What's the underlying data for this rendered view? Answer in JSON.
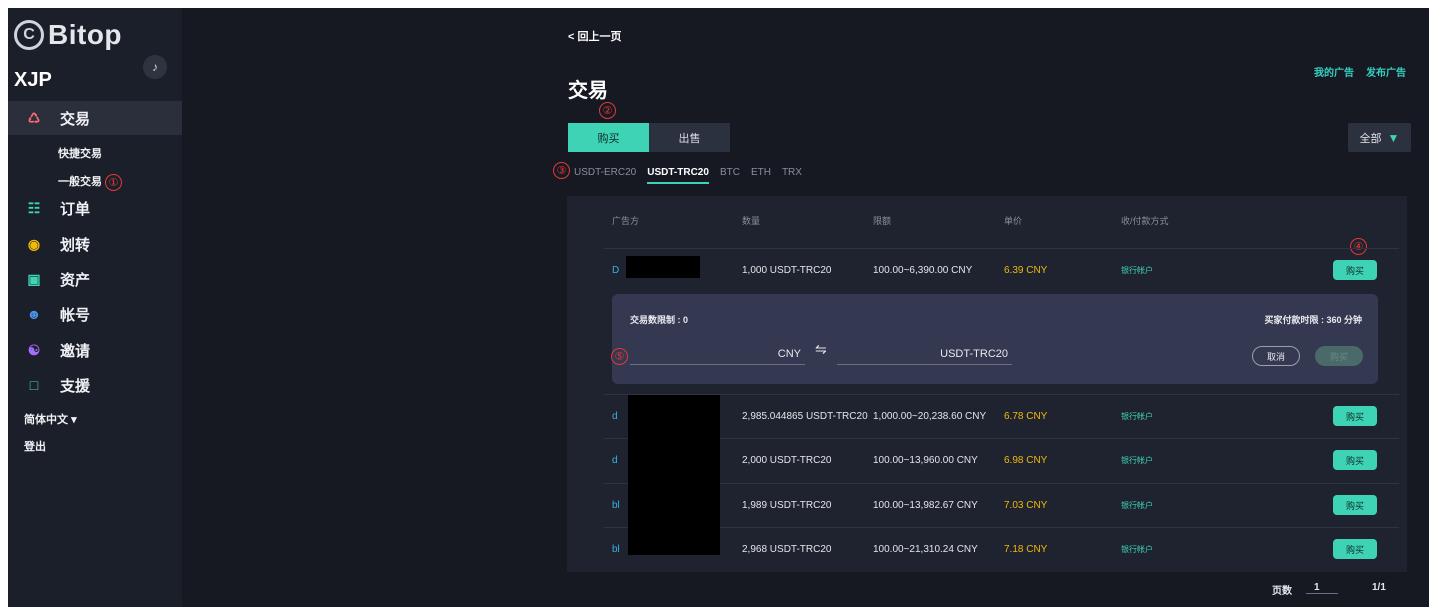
{
  "brand": {
    "name": "Bitop"
  },
  "user": {
    "name": "XJP"
  },
  "sidebar": {
    "items": [
      {
        "label": "交易",
        "icon": "trade-icon"
      },
      {
        "label": "订单",
        "icon": "order-icon"
      },
      {
        "label": "划转",
        "icon": "transfer-icon"
      },
      {
        "label": "资产",
        "icon": "wallet-icon"
      },
      {
        "label": "帐号",
        "icon": "account-icon"
      },
      {
        "label": "邀请",
        "icon": "invite-icon"
      },
      {
        "label": "支援",
        "icon": "support-icon"
      }
    ],
    "sub_items": [
      "快捷交易",
      "一般交易"
    ],
    "language": "简体中文",
    "logout": "登出"
  },
  "header": {
    "back": "< 回上一页",
    "title": "交易",
    "my_ads": "我的广告",
    "post_ad": "发布广告"
  },
  "tabs": {
    "buy": "购买",
    "sell": "出售"
  },
  "filter": {
    "label": "全部"
  },
  "coins": [
    "USDT-ERC20",
    "USDT-TRC20",
    "BTC",
    "ETH",
    "TRX"
  ],
  "selected_coin": "USDT-TRC20",
  "table": {
    "headers": [
      "广告方",
      "数量",
      "限额",
      "单价",
      "收/付款方式"
    ],
    "action_label": "购买",
    "rows": [
      {
        "advertiser": "D",
        "amount": "1,000 USDT-TRC20",
        "limit": "100.00~6,390.00 CNY",
        "price": "6.39 CNY",
        "method": "银行帐户"
      },
      {
        "advertiser": "d",
        "amount": "2,985.044865 USDT-TRC20",
        "limit": "1,000.00~20,238.60 CNY",
        "price": "6.78 CNY",
        "method": "银行帐户"
      },
      {
        "advertiser": "d",
        "amount": "2,000 USDT-TRC20",
        "limit": "100.00~13,960.00 CNY",
        "price": "6.98 CNY",
        "method": "银行帐户"
      },
      {
        "advertiser": "bl",
        "amount": "1,989 USDT-TRC20",
        "limit": "100.00~13,982.67 CNY",
        "price": "7.03 CNY",
        "method": "银行帐户"
      },
      {
        "advertiser": "bl",
        "amount": "2,968 USDT-TRC20",
        "limit": "100.00~21,310.24 CNY",
        "price": "7.18 CNY",
        "method": "银行帐户"
      }
    ]
  },
  "expand": {
    "limit_label": "交易数限制 : 0",
    "pay_time": "买家付款时限 : 360 分钟",
    "fiat_unit": "CNY",
    "crypto_unit": "USDT-TRC20",
    "cancel": "取消",
    "confirm": "购买"
  },
  "pager": {
    "label": "页数",
    "current": "1",
    "total": "1/1"
  },
  "annotations": [
    "①",
    "②",
    "③",
    "④",
    "⑤"
  ],
  "colors": {
    "accent": "#3ed3b5",
    "price": "#f0b90b",
    "link": "#35b3e8",
    "marker": "#e53935"
  }
}
